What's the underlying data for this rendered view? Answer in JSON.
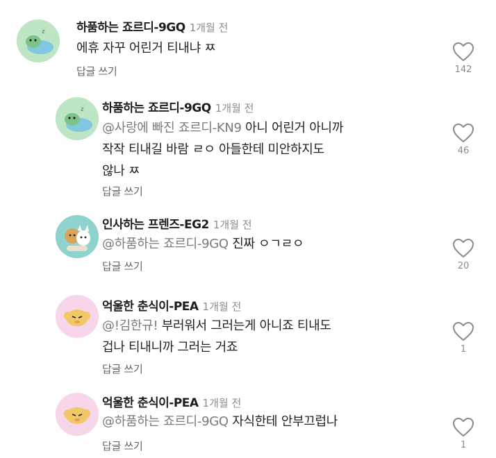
{
  "comments": [
    {
      "username": "하품하는 죠르디-9GQ",
      "time": "1개월 전",
      "mention": "",
      "lines": [
        "에휴 자꾸 어린거 티내냐 ㅉ"
      ],
      "reply_label": "답글 쓰기",
      "like_count": "142",
      "avatar": "jordy-yawning"
    },
    {
      "username": "하품하는 죠르디-9GQ",
      "time": "1개월 전",
      "mention": "@사랑에 빠진 죠르디-KN9",
      "lines": [
        " 아니 어린거 아니까",
        "작작 티내길 바람 ㄹㅇ 아들한테 미안하지도",
        "않나 ㅉ"
      ],
      "reply_label": "답글 쓰기",
      "like_count": "46",
      "avatar": "jordy-yawning"
    },
    {
      "username": "인사하는 프렌즈-EG2",
      "time": "1개월 전",
      "mention": "@하품하는 죠르디-9GQ",
      "lines": [
        " 진짜 ㅇㄱㄹㅇ"
      ],
      "reply_label": "답글 쓰기",
      "like_count": "20",
      "avatar": "friends-greeting"
    },
    {
      "username": "억울한 춘식이-PEA",
      "time": "1개월 전",
      "mention": "@!김한규!",
      "lines": [
        " 부러워서 그러는게 아니죠 티내도",
        "겁나 티내니까 그러는 거죠"
      ],
      "reply_label": "답글 쓰기",
      "like_count": "1",
      "avatar": "choonsik-sad"
    },
    {
      "username": "억울한 춘식이-PEA",
      "time": "1개월 전",
      "mention": "@하품하는 죠르디-9GQ",
      "lines": [
        " 자식한테 안부끄럽나"
      ],
      "reply_label": "답글 쓰기",
      "like_count": "1",
      "avatar": "choonsik-sad"
    }
  ],
  "icons": {
    "like": "heart-outline-icon"
  },
  "colors": {
    "mention": "#7a7a7a",
    "avatar_green": "#bfe6c4",
    "avatar_teal": "#8fd3cf",
    "avatar_pink": "#f7d6ea"
  }
}
